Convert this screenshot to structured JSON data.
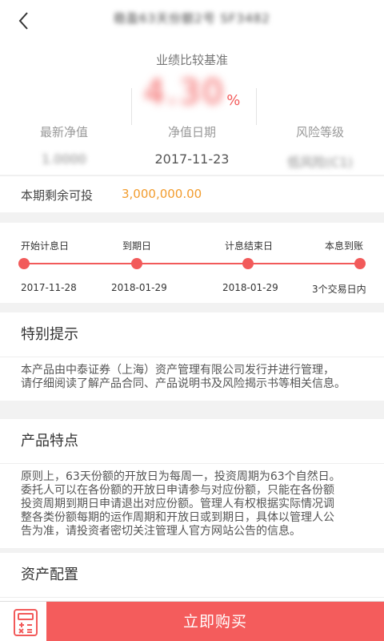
{
  "header": {
    "title": "稳盈63天份额2号 SF3482",
    "back_icon": "chevron-left-icon"
  },
  "hero": {
    "benchmark_label": "业绩比较基准",
    "rate_value": "4.30",
    "rate_unit": "%",
    "accent_color": "#f25a5a"
  },
  "stats": [
    {
      "label": "最新净值",
      "value": "1.0000"
    },
    {
      "label": "净值日期",
      "value": "2017-11-23"
    },
    {
      "label": "风险等级",
      "value": "低风险(C1)"
    }
  ],
  "remaining": {
    "label": "本期剩余可投",
    "value": "3,000,000.00",
    "color": "#f29c2e"
  },
  "timeline": [
    {
      "label": "开始计息日",
      "date": "2017-11-28"
    },
    {
      "label": "到期日",
      "date": "2018-01-29"
    },
    {
      "label": "计息结束日",
      "date": "2018-01-29"
    },
    {
      "label": "本息到账",
      "date": "3个交易日内"
    }
  ],
  "notice": {
    "title": "特别提示",
    "lines": [
      "本产品由中泰证券（上海）资产管理有限公司发行并进行管理，",
      "请仔细阅读了解产品合同、产品说明书及风险揭示书等相关信息。"
    ]
  },
  "features": {
    "title": "产品特点",
    "lines": [
      "原则上，63天份额的开放日为每周一，投资周期为63个自然日。",
      "委托人可以在各份额的开放日申请参与对应份额，只能在各份额",
      "投资周期到期日申请退出对应份额。管理人有权根据实际情况调",
      "整各类份额每期的运作周期和开放日或到期日，具体以管理人公",
      "告为准，请投资者密切关注管理人官方网站公告的信息。"
    ]
  },
  "allocation": {
    "title": "资产配置"
  },
  "bottom": {
    "buy_label": "立即购买",
    "calc_icon": "calculator-icon",
    "buy_color": "#f45c5c"
  }
}
